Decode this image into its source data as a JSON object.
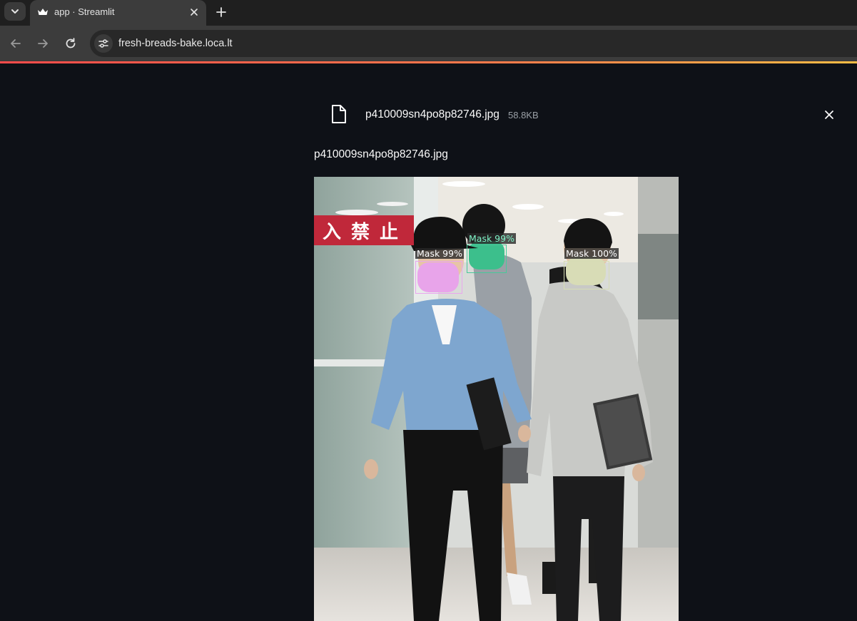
{
  "browser": {
    "tab_title": "app · Streamlit",
    "url": "fresh-breads-bake.loca.lt",
    "favicon": "streamlit-crown-icon"
  },
  "uploader": {
    "file_name": "p410009sn4po8p82746.jpg",
    "file_size": "58.8KB"
  },
  "image": {
    "caption": "p410009sn4po8p82746.jpg",
    "sign_text": "入禁止",
    "detections": [
      {
        "label": "Mask 99%",
        "color": "#e9a6ee"
      },
      {
        "label": "Mask 99%",
        "color": "#48c89a"
      },
      {
        "label": "Mask 100%",
        "color": "#d6dcb4"
      }
    ]
  },
  "colors": {
    "app_background": "#0e1117",
    "text": "#fafafa",
    "accent_gradient_start": "#ff4b4b",
    "accent_gradient_end": "#ffbd45"
  }
}
